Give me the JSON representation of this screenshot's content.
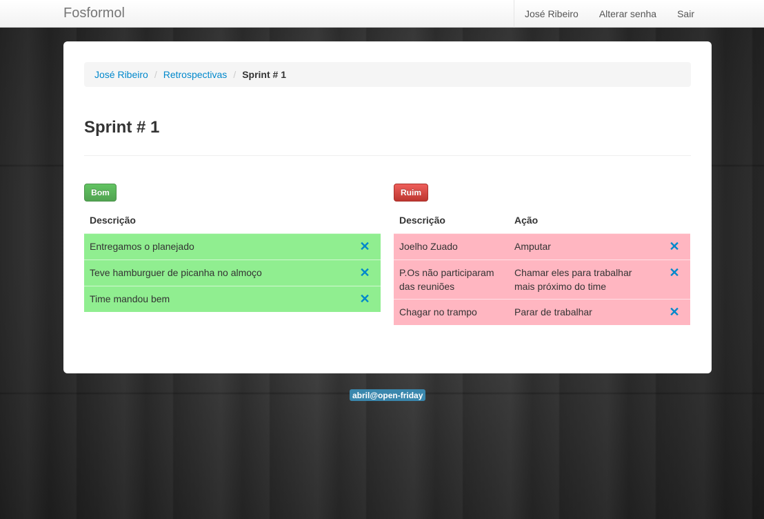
{
  "navbar": {
    "brand": "Fosformol",
    "links": [
      "José Ribeiro",
      "Alterar senha",
      "Sair"
    ]
  },
  "breadcrumb": {
    "items": [
      "José Ribeiro",
      "Retrospectivas"
    ],
    "active": "Sprint # 1",
    "divider": "/"
  },
  "page_title": "Sprint # 1",
  "bom": {
    "label": "Bom",
    "header": "Descrição",
    "rows": [
      "Entregamos o planejado",
      "Teve hamburguer de picanha no almoço",
      "Time mandou bem"
    ],
    "row_color": "#90ee90"
  },
  "ruim": {
    "label": "Ruim",
    "headers": [
      "Descrição",
      "Ação"
    ],
    "rows": [
      {
        "descricao": "Joelho Zuado",
        "acao": "Amputar"
      },
      {
        "descricao": "P.Os não participaram das reuniões",
        "acao": "Chamar eles para trabalhar mais próximo do time"
      },
      {
        "descricao": "Chagar no trampo",
        "acao": "Parar de trabalhar"
      }
    ],
    "row_color": "#ffb6c1"
  },
  "delete_icon": "close-icon",
  "delete_glyph": "✕",
  "footer": {
    "badge": "abril@open-friday"
  },
  "colors": {
    "link": "#0088cc",
    "success": "#51a351",
    "danger": "#bd362f",
    "badge": "#3a87ad"
  }
}
